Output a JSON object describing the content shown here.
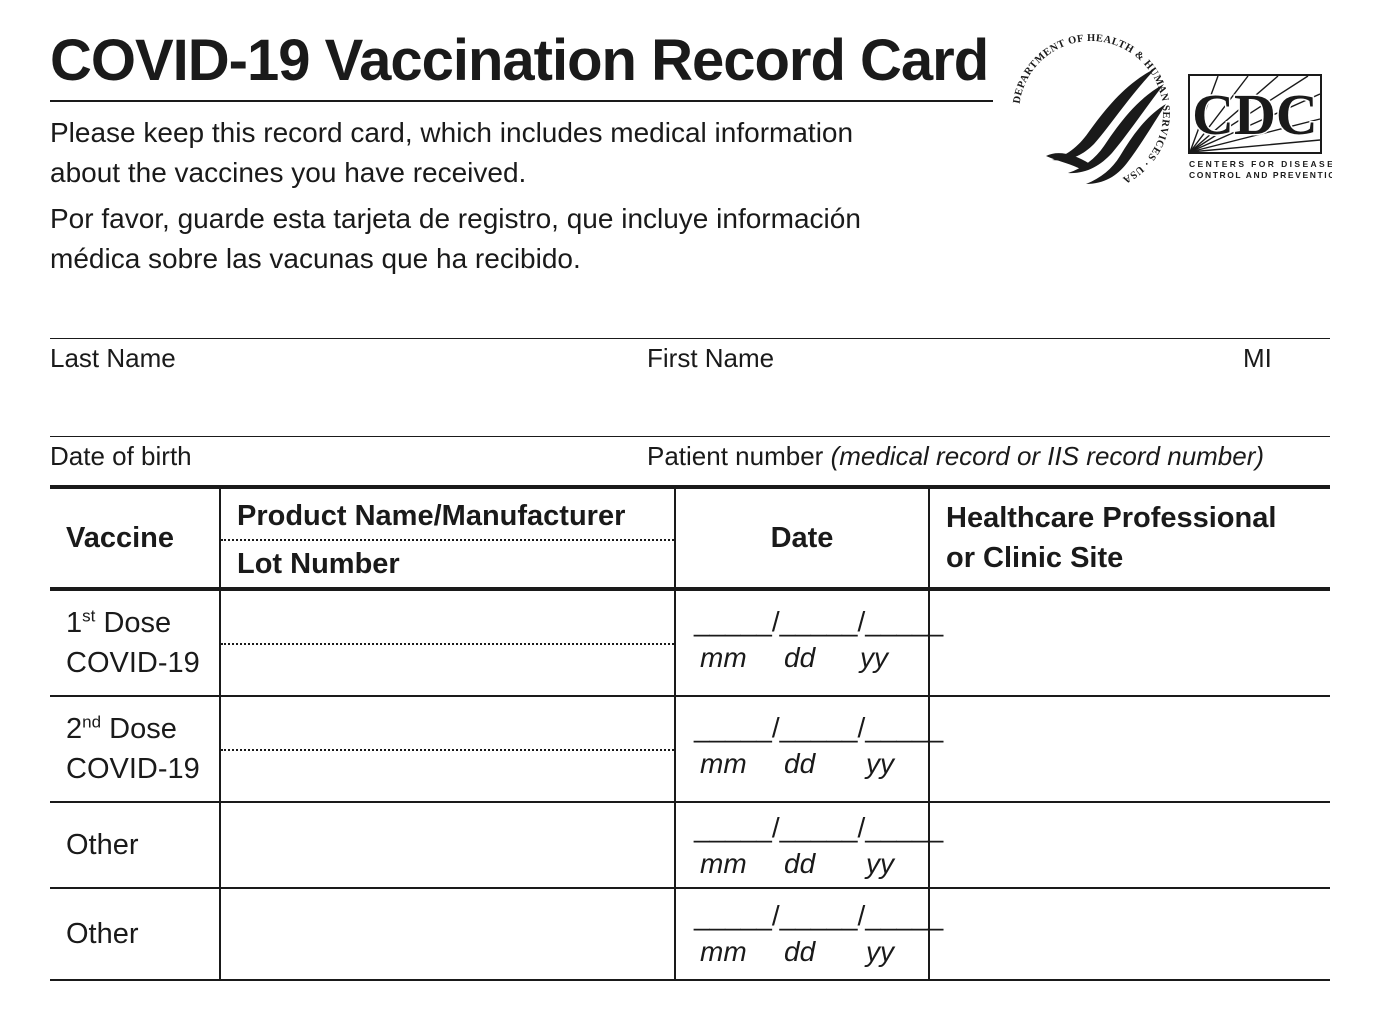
{
  "title": "COVID-19 Vaccination Record Card",
  "intro": {
    "en_line1": "Please keep this record card, which includes medical information",
    "en_line2": "about the vaccines you have received.",
    "es_line1": "Por favor, guarde esta tarjeta de registro, que incluye información",
    "es_line2": "médica sobre las vacunas que ha recibido."
  },
  "logos": {
    "hhs_seal_text": "DEPARTMENT OF HEALTH & HUMAN SERVICES · USA",
    "cdc_mark": "CDC",
    "cdc_line1": "CENTERS FOR DISEASE",
    "cdc_line2": "CONTROL AND PREVENTION"
  },
  "fields": {
    "last_name": "Last Name",
    "first_name": "First Name",
    "mi": "MI",
    "dob": "Date of birth",
    "patient_number": "Patient number",
    "patient_number_note": "(medical record or IIS record number)"
  },
  "table": {
    "headers": {
      "vaccine": "Vaccine",
      "product": "Product Name/Manufacturer",
      "lot": "Lot Number",
      "date": "Date",
      "hcp_line1": "Healthcare Professional",
      "hcp_line2": "or Clinic Site"
    },
    "date_blank": "_____/_____/_____",
    "date_parts": {
      "mm": "mm",
      "dd": "dd",
      "yy": "yy"
    },
    "rows": [
      {
        "dose_num": "1",
        "dose_sup": "st",
        "dose_word": "Dose",
        "line2": "COVID-19"
      },
      {
        "dose_num": "2",
        "dose_sup": "nd",
        "dose_word": "Dose",
        "line2": "COVID-19"
      },
      {
        "label": "Other"
      },
      {
        "label": "Other"
      }
    ]
  },
  "colors": {
    "ink": "#1a1a1a",
    "paper": "#ffffff"
  }
}
